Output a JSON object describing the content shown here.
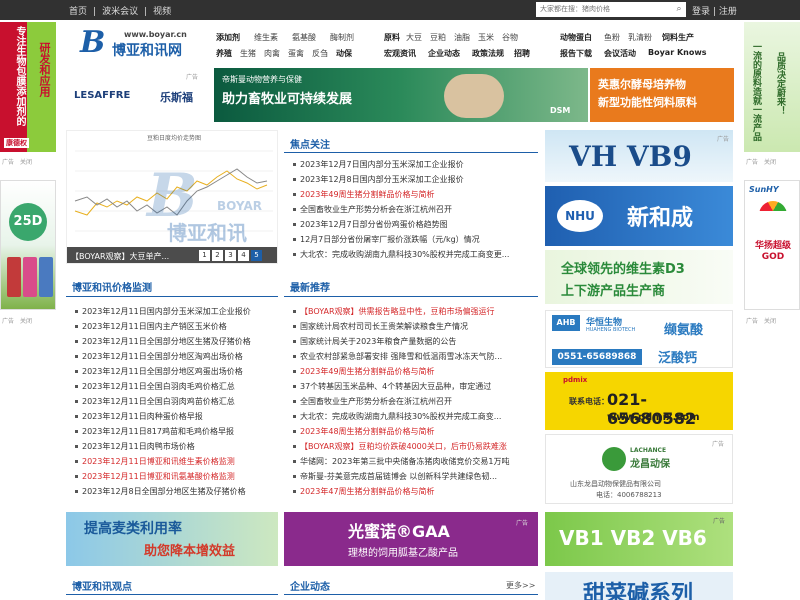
{
  "topbar": {
    "nav": [
      "首页",
      "|",
      "波米会议",
      "|",
      "视频"
    ],
    "search_placeholder": "大家都在搜：猪肉价格",
    "login": "登录",
    "sep": "|",
    "register": "注册"
  },
  "left_ads": {
    "ad1_text": "专注生物包膜添加剂的",
    "ad1_text2": "研发和应用",
    "ad1_brand": "康德权",
    "close": "关闭",
    "adtag": "广告",
    "ad2_text": "25D"
  },
  "right_ads": {
    "ad1_text": "一流的原料造就一流产品",
    "ad1_text2": "品质决定蔚来！",
    "close": "关闭",
    "adtag": "广告",
    "ad2_brand": "SunHY",
    "ad2_text": "华扬超级GOD"
  },
  "logo": {
    "url": "www.boyar.cn",
    "name": "博亚和讯网",
    "letter": "B"
  },
  "catnav": {
    "row1": [
      "添加剂",
      "维生素",
      "氨基酸",
      "酶制剂",
      "原料",
      "大豆",
      "豆粕",
      "油脂",
      "玉米",
      "谷物",
      "动物蛋白",
      "鱼粉",
      "乳清粉",
      "饲料生产"
    ],
    "row2": [
      "养殖",
      "生猪",
      "肉禽",
      "蛋禽",
      "反刍",
      "动保",
      "宏观资讯",
      "企业动态",
      "政策法规",
      "招聘",
      "报告下载",
      "会议活动",
      "Boyar Knows"
    ]
  },
  "banners": {
    "lesaffre_en": "LESAFFRE",
    "lesaffre_cn": "乐斯福",
    "adtag": "广告",
    "lesaffre_sub": "帝斯曼动物营养与保健",
    "lesaffre_main": "助力畜牧业可持续发展",
    "dsm": "DSM",
    "angel_line1": "英惠尔酵母培养物",
    "angel_line2": "新型功能性饲料原料"
  },
  "slider": {
    "caption": "【BOYAR观察】大豆单产...",
    "chart_title": "豆粕日度均价走势图",
    "watermark": "博亚和讯",
    "watermark_en": "BOYAR",
    "pages": [
      "1",
      "2",
      "3",
      "4",
      "5"
    ]
  },
  "focus": {
    "title": "焦点关注",
    "items": [
      {
        "text": "2023年12月7日国内部分玉米深加工企业报价",
        "red": false
      },
      {
        "text": "2023年12月8日国内部分玉米深加工企业报价",
        "red": false
      },
      {
        "text": "2023年49周生猪分割鲜品价格与简析",
        "red": true
      },
      {
        "text": "全国畜牧业生产形势分析会在浙江杭州召开",
        "red": false
      },
      {
        "text": "2023年12月7日部分省份鸡蛋价格趋势图",
        "red": false
      },
      {
        "text": "12月7日部分省份屠宰厂报价涨跌幅（元/kg）情况",
        "red": false
      },
      {
        "text": "大北农：完成收购湖南九鼎科技30%股权并完成工商变更...",
        "red": false
      }
    ]
  },
  "price_monitor": {
    "title": "博亚和讯价格监测",
    "items": [
      {
        "text": "2023年12月11日国内部分玉米深加工企业报价",
        "red": false
      },
      {
        "text": "2023年12月11日国内主产销区玉米价格",
        "red": false
      },
      {
        "text": "2023年12月11日全国部分地区生猪及仔猪价格",
        "red": false
      },
      {
        "text": "2023年12月11日全国部分地区淘鸡出场价格",
        "red": false
      },
      {
        "text": "2023年12月11日全国部分地区鸡蛋出场价格",
        "red": false
      },
      {
        "text": "2023年12月11日全国白羽肉毛鸡价格汇总",
        "red": false
      },
      {
        "text": "2023年12月11日全国白羽肉鸡苗价格汇总",
        "red": false
      },
      {
        "text": "2023年12月11日肉种蛋价格早报",
        "red": false
      },
      {
        "text": "2023年12月11日817鸡苗和毛鸡价格早报",
        "red": false
      },
      {
        "text": "2023年12月11日肉鸭市场价格",
        "red": false
      },
      {
        "text": "2023年12月11日博亚和讯维生素价格监测",
        "red": true
      },
      {
        "text": "2023年12月11日博亚和讯氨基酸价格监测",
        "red": true
      },
      {
        "text": "2023年12月8日全国部分地区生猪及仔猪价格",
        "red": false
      }
    ]
  },
  "latest": {
    "title": "最新推荐",
    "items": [
      {
        "text": "【BOYAR观察】供需报告略显中性，豆粕市场偏强运行",
        "red": true
      },
      {
        "text": "国家统计局农村司司长王贵荣解读粮食生产情况",
        "red": false
      },
      {
        "text": "国家统计局关于2023年粮食产量数据的公告",
        "red": false
      },
      {
        "text": "农业农村部紧急部署安排 强降雪和低温雨雪冰冻天气防...",
        "red": false
      },
      {
        "text": "2023年49周生猪分割鲜品价格与简析",
        "red": true
      },
      {
        "text": "37个转基因玉米品种、4个转基因大豆品种，审定通过",
        "red": false
      },
      {
        "text": "全国畜牧业生产形势分析会在浙江杭州召开",
        "red": false
      },
      {
        "text": "大北农：完成收购湖南九鼎科技30%股权并完成工商变...",
        "red": false
      },
      {
        "text": "2023年48周生猪分割鲜品价格与简析",
        "red": true
      },
      {
        "text": "【BOYAR观察】豆粕均价跌破4000关口，后市仍易跌难涨",
        "red": true
      },
      {
        "text": "华储网：2023年第三批中央储备冻猪肉收储竞价交易1万吨",
        "red": false
      },
      {
        "text": "帝斯曼-芬美意完成首届链博会 以创新科学共建绿色韧...",
        "red": false
      },
      {
        "text": "2023年47周生猪分割鲜品价格与简析",
        "red": true
      }
    ]
  },
  "right_column_ads": {
    "adtag": "广告",
    "vhvb9": "VH VB9",
    "nhu_en": "NHU",
    "nhu_cn": "新和成",
    "vitd3_line1": "全球领先的维生素D3",
    "vitd3_line2": "上下游产品生产商",
    "huaxing_brand": "华恒生物",
    "huaxing_brand_en": "HUAHENG BIOTECH",
    "huaxing_p1": "缬氨酸",
    "huaxing_p2": "泛酸钙",
    "huaxing_phone": "0551-65689868",
    "pdmix_brand": "pdmix",
    "pdmix_label": "联系电话：",
    "pdmix_phone": "021-65680582",
    "pdmix_url": "www.pdmix.com",
    "lachance_en": "LACHANCE",
    "lachance_cn": "龙昌动保",
    "lachance_company": "山东龙昌动物保健品有限公司",
    "lachance_phone": "电话：4006788213"
  },
  "bottom_ads": {
    "wheat_line1": "提高麦类利用率",
    "wheat_line2": "助您降本增效益",
    "gaa_main": "光蜜诺®GAA",
    "gaa_sub": "理想的饲用胍基乙酸产品",
    "adtag": "广告",
    "vb": "VB1 VB2 VB6",
    "sweet": "甜菜碱系列"
  },
  "bottom_sections": {
    "view_title": "博亚和讯观点",
    "company_title": "企业动态",
    "more": "更多>>"
  }
}
